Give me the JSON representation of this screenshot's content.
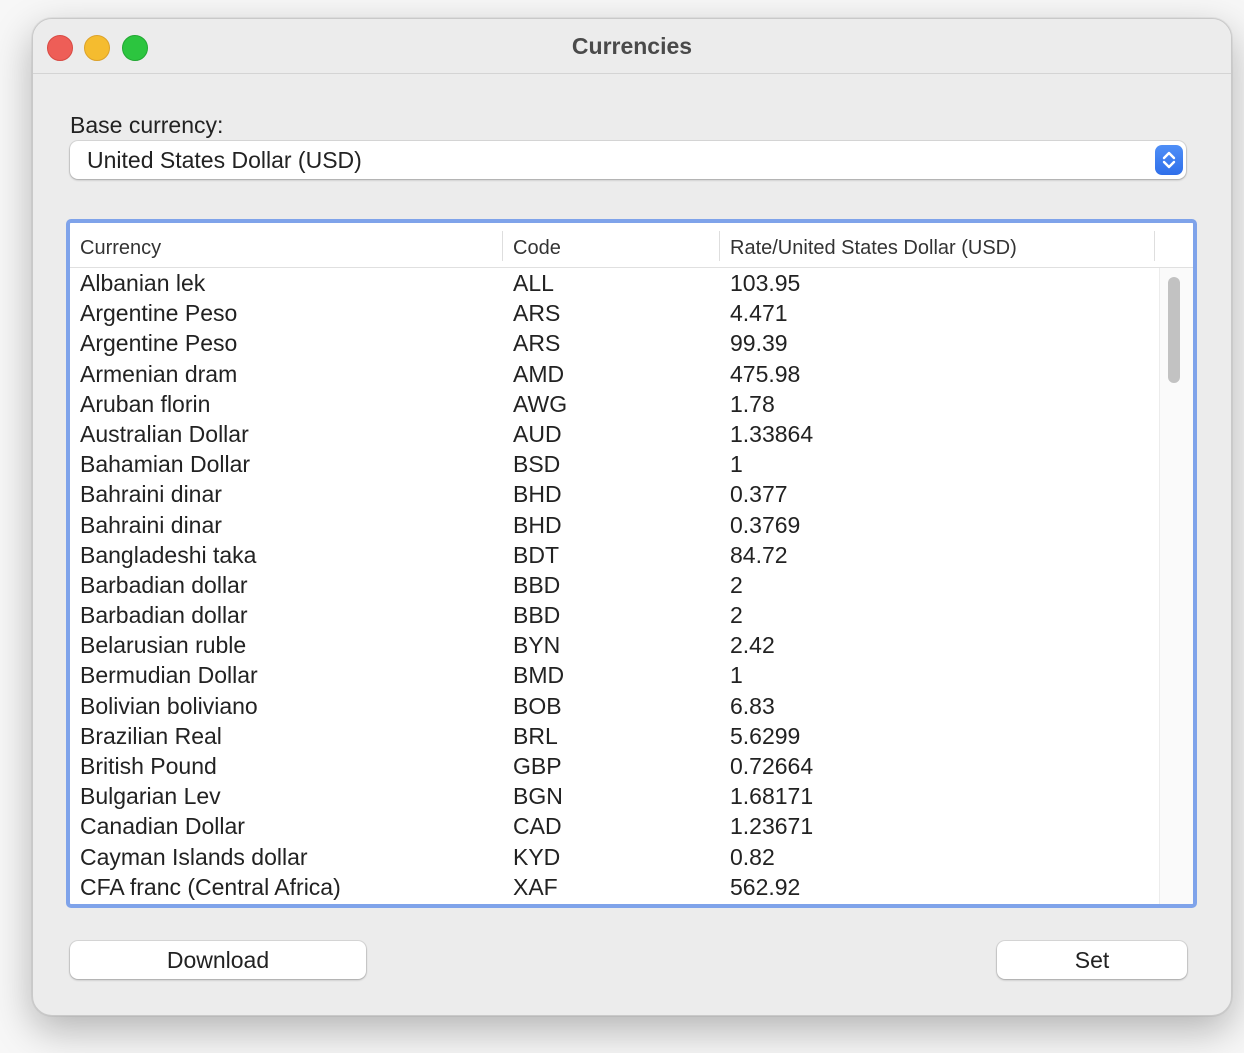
{
  "window": {
    "title": "Currencies"
  },
  "base": {
    "label": "Base currency:",
    "selected": "United States Dollar (USD)"
  },
  "table": {
    "headers": [
      "Currency",
      "Code",
      "Rate/United States Dollar (USD)"
    ],
    "rows": [
      [
        "Albanian lek",
        "ALL",
        "103.95"
      ],
      [
        "Argentine Peso",
        "ARS",
        "4.471"
      ],
      [
        "Argentine Peso",
        "ARS",
        "99.39"
      ],
      [
        "Armenian dram",
        "AMD",
        "475.98"
      ],
      [
        "Aruban florin",
        "AWG",
        "1.78"
      ],
      [
        "Australian Dollar",
        "AUD",
        "1.33864"
      ],
      [
        "Bahamian Dollar",
        "BSD",
        "1"
      ],
      [
        "Bahraini dinar",
        "BHD",
        "0.377"
      ],
      [
        "Bahraini dinar",
        "BHD",
        "0.3769"
      ],
      [
        "Bangladeshi taka",
        "BDT",
        "84.72"
      ],
      [
        "Barbadian dollar",
        "BBD",
        "2"
      ],
      [
        "Barbadian dollar",
        "BBD",
        "2"
      ],
      [
        "Belarusian ruble",
        "BYN",
        "2.42"
      ],
      [
        "Bermudian Dollar",
        "BMD",
        "1"
      ],
      [
        "Bolivian boliviano",
        "BOB",
        "6.83"
      ],
      [
        "Brazilian Real",
        "BRL",
        "5.6299"
      ],
      [
        "British Pound",
        "GBP",
        "0.72664"
      ],
      [
        "Bulgarian Lev",
        "BGN",
        "1.68171"
      ],
      [
        "Canadian Dollar",
        "CAD",
        "1.23671"
      ],
      [
        "Cayman Islands dollar",
        "KYD",
        "0.82"
      ],
      [
        "CFA franc (Central Africa)",
        "XAF",
        "562.92"
      ]
    ]
  },
  "buttons": {
    "download": "Download",
    "set": "Set"
  },
  "icons": {
    "close": "close-button-icon",
    "minimize": "minimize-button-icon",
    "zoom": "zoom-button-icon",
    "stepper": "chevron-up-down-icon"
  },
  "colors": {
    "close": "#ee5e57",
    "minimize": "#f5bc2f",
    "zoom": "#2cc53f",
    "accent": "#2f6fea",
    "focus_ring": "#7fa3ea"
  }
}
